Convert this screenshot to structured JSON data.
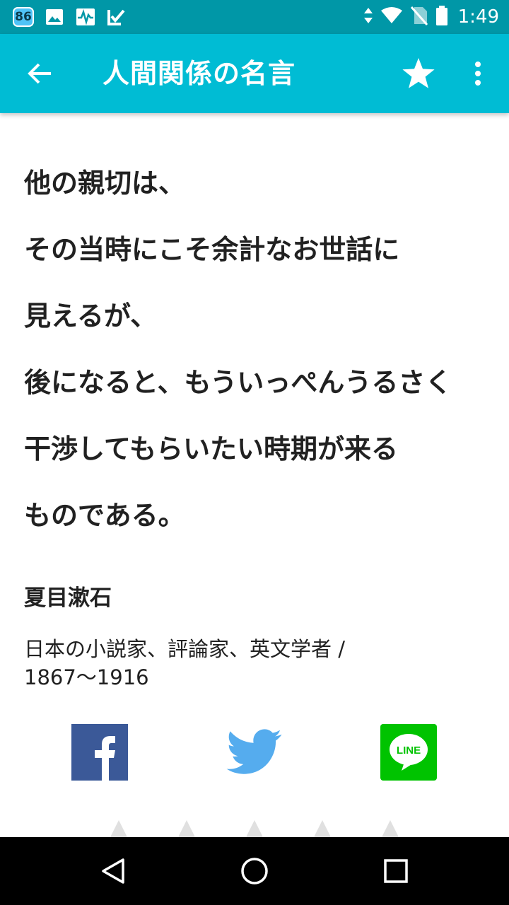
{
  "status_bar": {
    "notification_badge": "86",
    "time": "1:49",
    "icons": [
      "image-icon",
      "activity-icon",
      "check-icon",
      "data-arrows-icon",
      "wifi-icon",
      "no-sim-icon",
      "battery-icon"
    ]
  },
  "app_bar": {
    "title": "人間関係の名言",
    "icons": [
      "back-arrow-icon",
      "star-icon",
      "more-vert-icon"
    ],
    "color": "#00bcd4"
  },
  "quote": {
    "lines": [
      "他の親切は、",
      "その当時にこそ余計なお世話に",
      "見えるが、",
      "後になると、もういっぺんうるさく",
      "干渉してもらいたい時期が来る",
      "ものである。"
    ]
  },
  "author": {
    "name": "夏目漱石",
    "description_line1": "日本の小説家、評論家、英文学者 /",
    "description_line2": "1867〜1916"
  },
  "share": {
    "facebook_label": "f",
    "line_label": "LINE",
    "colors": {
      "facebook": "#3b5998",
      "twitter": "#55acee",
      "line": "#00c300"
    }
  },
  "nav_bar": {
    "icons": [
      "back-triangle-icon",
      "home-circle-icon",
      "recents-square-icon"
    ]
  }
}
